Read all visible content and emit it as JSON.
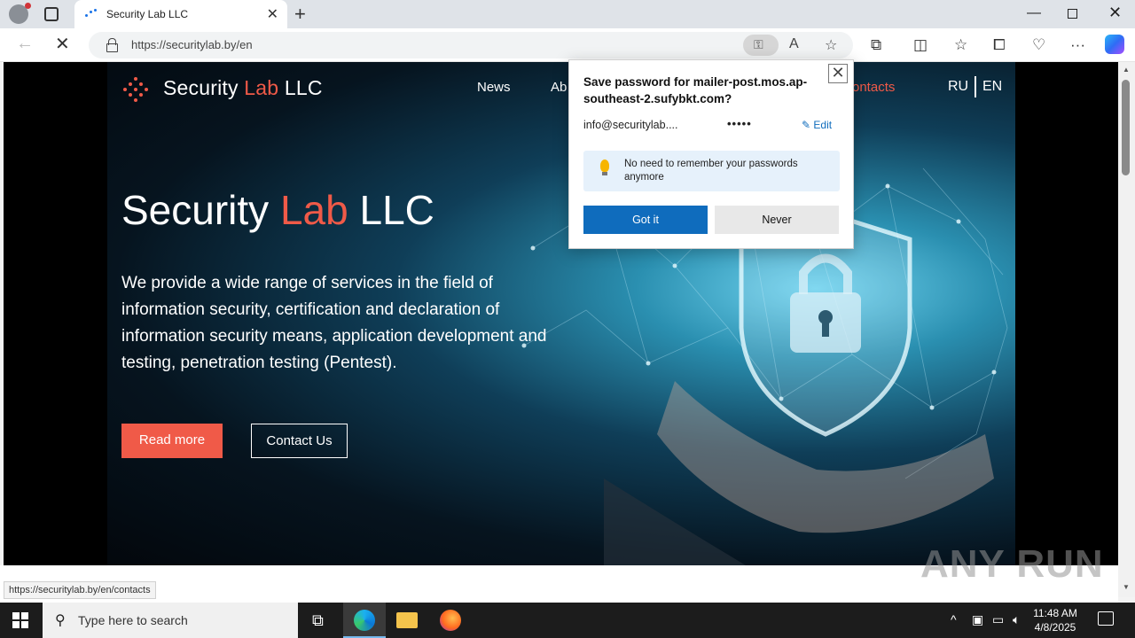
{
  "browser": {
    "tab_title": "Security Lab LLC",
    "url": "https://securitylab.by/en",
    "status_url": "https://securitylab.by/en/contacts"
  },
  "site": {
    "logo_word1": "Security",
    "logo_word2": "Lab",
    "logo_word3": "LLC",
    "nav": {
      "news": "News",
      "about_partial": "Ab",
      "contacts_partial": "ontacts",
      "lang_ru": "RU",
      "lang_en": "EN"
    },
    "hero_title_1": "Security",
    "hero_title_2": "Lab",
    "hero_title_3": "LLC",
    "hero_text": "We provide a wide range of services in the field of information security, certification and declaration of information security means, application development and testing, penetration testing (Pentest).",
    "read_more": "Read more",
    "contact_us": "Contact Us",
    "accent_color": "#f05a48"
  },
  "password_popup": {
    "title": "Save password for mailer-post.mos.ap-southeast-2.sufybkt.com?",
    "username": "info@securitylab....",
    "password_mask": "•••••",
    "edit": "Edit",
    "tip": "No need to remember your passwords anymore",
    "got_it": "Got it",
    "never": "Never"
  },
  "watermark": "ANY RUN",
  "taskbar": {
    "search_placeholder": "Type here to search",
    "time": "11:48 AM",
    "date": "4/8/2025"
  }
}
